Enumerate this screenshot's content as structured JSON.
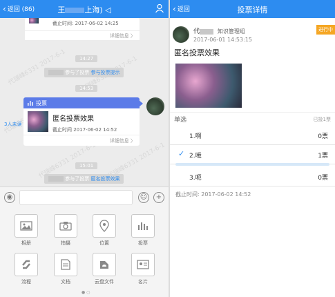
{
  "left": {
    "header": {
      "back_label": "返回 (86)",
      "title_prefix": "王",
      "title_suffix": "上海)"
    },
    "prev_card": {
      "time_text": "截止时间: 2017-06-02 14:25",
      "detail_label": "详细信息 〉"
    },
    "time1": "14:27",
    "sys1": {
      "text": "参与了投票",
      "link": "参与投票提示"
    },
    "time2": "14:53",
    "vote_card": {
      "header": "投票",
      "title": "匿名投票效果",
      "time_text": "截止时间 2017-06-02 14:52",
      "detail_label": "详细信息 〉"
    },
    "unread": "3人未读",
    "time3": "15:01",
    "sys2": {
      "text": "参与了投票",
      "link": "匿名投票效果"
    },
    "tools": [
      {
        "label": "相册",
        "icon": "image-icon"
      },
      {
        "label": "拍摄",
        "icon": "camera-icon"
      },
      {
        "label": "位置",
        "icon": "location-icon"
      },
      {
        "label": "投票",
        "icon": "chart-icon"
      },
      {
        "label": "流程",
        "icon": "flow-icon"
      },
      {
        "label": "文档",
        "icon": "document-icon"
      },
      {
        "label": "云盘文件",
        "icon": "cloud-icon"
      },
      {
        "label": "名片",
        "icon": "card-icon"
      }
    ],
    "watermark": "代瑞峰6331 2017-6-1"
  },
  "right": {
    "header": {
      "back_label": "返回",
      "title": "投票详情"
    },
    "author": {
      "name_prefix": "代",
      "group": "知识管理组",
      "time": "2017-06-01 14:53:15"
    },
    "status": "进行中",
    "vote_title": "匿名投票效果",
    "type_label": "单选",
    "voted_count": "已投1票",
    "options": [
      {
        "name": "1.啊",
        "votes": "0票",
        "checked": false
      },
      {
        "name": "2.哦",
        "votes": "1票",
        "checked": true
      },
      {
        "name": "3.呃",
        "votes": "0票",
        "checked": false
      }
    ],
    "deadline": "截止时间: 2017-06-02 14:52"
  },
  "colors": {
    "accent": "#2d8cf0",
    "vote_header": "#5b7be8",
    "badge": "#f5a623"
  }
}
